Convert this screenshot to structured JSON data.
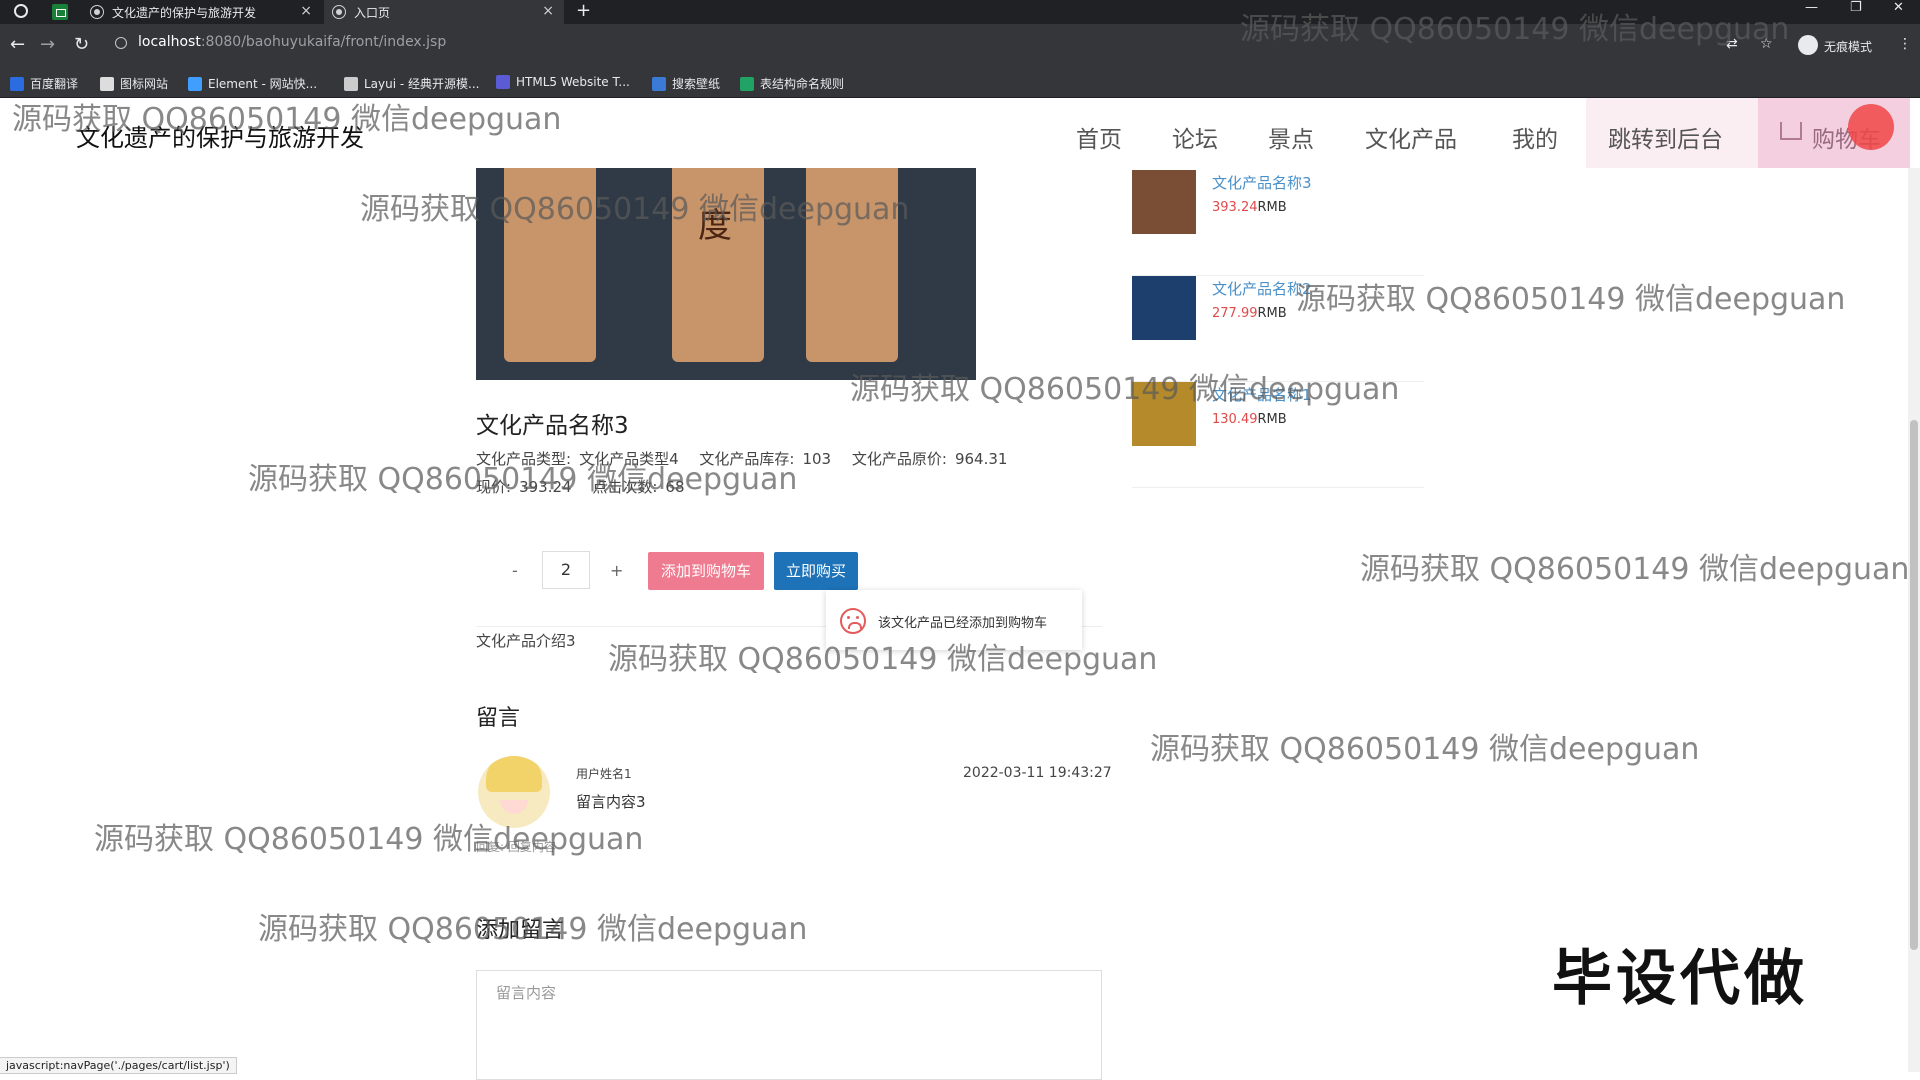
{
  "browser": {
    "tabs": [
      {
        "label": "文化遗产的保护与旅游开发"
      },
      {
        "label": "入口页"
      }
    ],
    "url_host": "localhost",
    "url_path": ":8080/baohuyukaifa/front/index.jsp",
    "incognito_label": "无痕模式",
    "bookmarks": [
      {
        "label": "百度翻译",
        "color": "#2b6de0"
      },
      {
        "label": "图标网站",
        "color": "#dddddd"
      },
      {
        "label": "Element - 网站快...",
        "color": "#409eff"
      },
      {
        "label": "Layui - 经典开源模...",
        "color": "#cccccc"
      },
      {
        "label": "HTML5 Website T...",
        "color": "#5b5bd6"
      },
      {
        "label": "搜索壁纸",
        "color": "#3b7bd6"
      },
      {
        "label": "表结构命名规则",
        "color": "#21a366"
      }
    ],
    "status_url": "javascript:navPage('./pages/cart/list.jsp')"
  },
  "site": {
    "brand": "文化遗产的保护与旅游开发",
    "nav": [
      "首页",
      "论坛",
      "景点",
      "文化产品",
      "我的",
      "跳转到后台",
      "购物车"
    ]
  },
  "product": {
    "title": "文化产品名称3",
    "type_label": "文化产品类型:",
    "type_value": "文化产品类型4",
    "stock_label": "文化产品库存:",
    "stock_value": "103",
    "orig_price_label": "文化产品原价:",
    "orig_price_value": "964.31",
    "price_label": "现价:",
    "price_value": "393.24",
    "clicks_label": "点击次数:",
    "clicks_value": "68",
    "quantity": "2",
    "minus": "-",
    "plus": "+",
    "add_cart_label": "添加到购物车",
    "buy_now_label": "立即购买",
    "toast": "该文化产品已经添加到购物车",
    "intro": "文化产品介绍3"
  },
  "comments": {
    "title": "留言",
    "items": [
      {
        "user": "用户姓名1",
        "content": "留言内容3",
        "time": "2022-03-11 19:43:27",
        "reply": "回复: 回复内容"
      }
    ],
    "add_title": "添加留言",
    "placeholder": "留言内容"
  },
  "sidebar": [
    {
      "name": "文化产品名称3",
      "price": "393.24",
      "unit": "RMB"
    },
    {
      "name": "文化产品名称2",
      "price": "277.99",
      "unit": "RMB"
    },
    {
      "name": "文化产品名称1",
      "price": "130.49",
      "unit": "RMB"
    }
  ],
  "overlays": {
    "watermark": "源码获取 QQ86050149 微信deepguan",
    "big_mark": "毕设代做"
  },
  "colors": {
    "add_cart": "#ee7b8f",
    "buy_now": "#1e73b8",
    "price_red": "#e04a4a",
    "link_blue": "#4a90c8"
  }
}
